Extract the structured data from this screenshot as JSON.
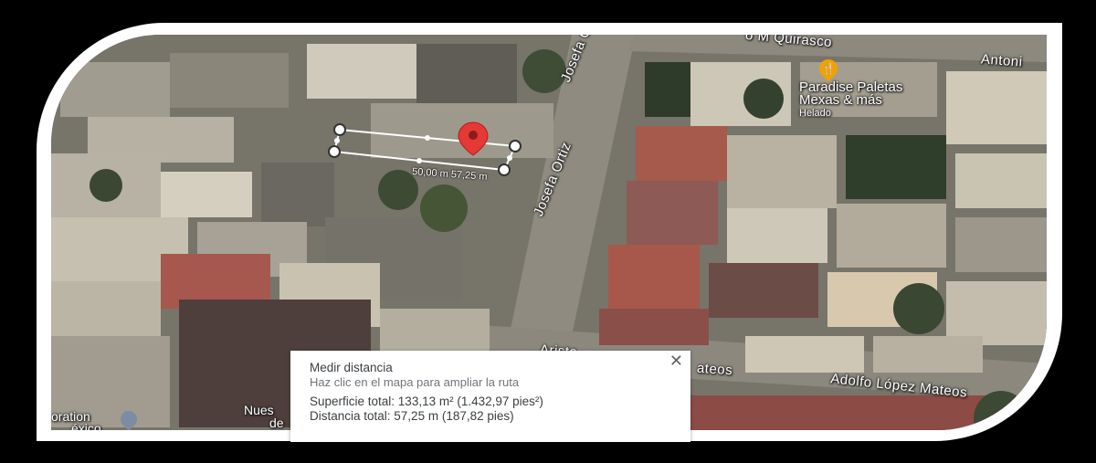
{
  "streets": {
    "top": "o M Quirasco",
    "top_right": "Antoni",
    "vertical_upper": "Josefa Ortiz",
    "vertical_lower": "Josefa Ortiz",
    "bottom_a": "Arista",
    "bottom_b": "ateos",
    "bottom_long": "Adolfo López Mateos"
  },
  "poi": {
    "name_line1": "Paradise Paletas",
    "name_line2": "Mexas & más",
    "category": "Helado",
    "icon": "ice-cream-icon"
  },
  "bottom_left_labels": {
    "label1_line1": "oration",
    "label1_line2": "éxico",
    "label2_line1": "Nues",
    "label2_line2": "de"
  },
  "measure": {
    "segment_label": "50,00 m 57,25 m"
  },
  "info_panel": {
    "title": "Medir distancia",
    "hint": "Haz clic en el mapa para ampliar la ruta",
    "area": "Superficie total: 133,13 m² (1.432,97 pies²)",
    "distance": "Distancia total: 57,25 m (187,82 pies)",
    "close_symbol": "✕"
  },
  "colors": {
    "marker": "#e53935",
    "poi_pin": "#f2a200"
  }
}
